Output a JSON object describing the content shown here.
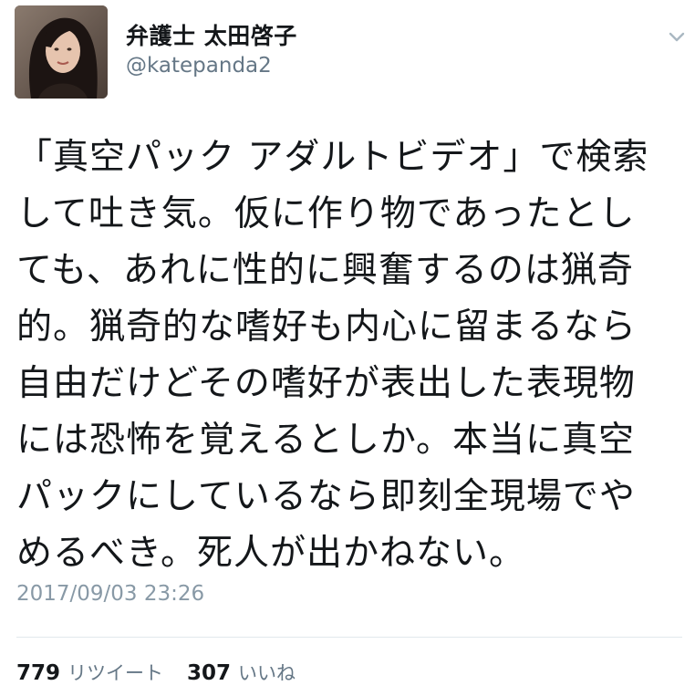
{
  "author": {
    "display_name": "弁護士 太田啓子",
    "handle": "@katepanda2"
  },
  "tweet": {
    "lines": [
      "「真空パック アダルトビデオ」で検索",
      "して吐き気。仮に作り物であったとし",
      "ても、あれに性的に興奮するのは猟奇",
      "的。猟奇的な嗜好も内心に留まるなら",
      "自由だけどその嗜好が表出した表現物",
      "には恐怖を覚えるとしか。本当に真空",
      "パックにしているなら即刻全現場でや",
      "めるべき。死人が出かねない。"
    ],
    "timestamp": "2017/09/03 23:26"
  },
  "stats": {
    "retweet_count": "779",
    "retweet_label": "リツイート",
    "like_count": "307",
    "like_label": "いいね"
  },
  "icons": {
    "menu": "chevron-down-icon"
  }
}
